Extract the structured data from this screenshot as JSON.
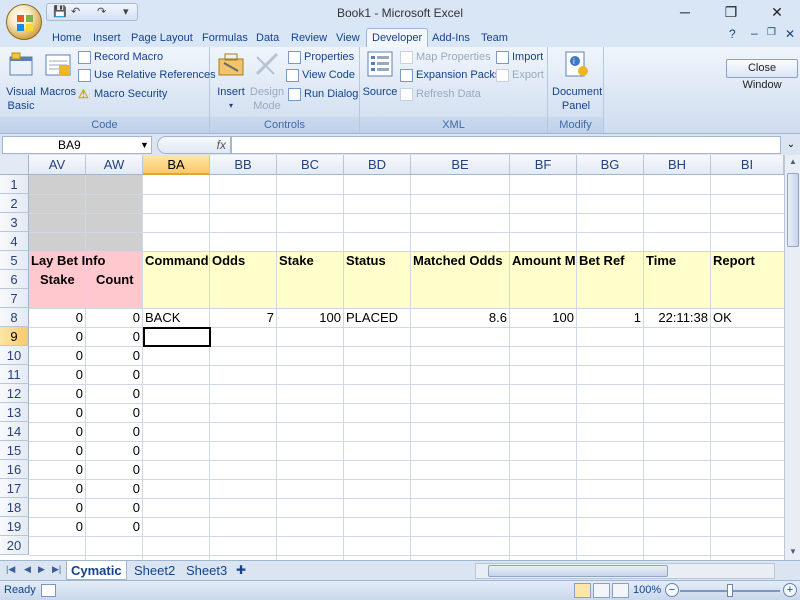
{
  "window": {
    "title": "Book1 - Microsoft Excel",
    "minimize": "─",
    "restore": "❐",
    "close": "✕"
  },
  "qat": {
    "save": "💾",
    "undo": "↶",
    "redo": "↷",
    "customize": "▾"
  },
  "tabs": [
    "Home",
    "Insert",
    "Page Layout",
    "Formulas",
    "Data",
    "Review",
    "View",
    "Developer",
    "Add-Ins",
    "Team"
  ],
  "active_tab": "Developer",
  "ribbon_right": {
    "help": "?",
    "mini": "–",
    "restore": "❐",
    "close": "✕"
  },
  "ribbon": {
    "code": {
      "label": "Code",
      "visual_basic": "Visual Basic",
      "macros": "Macros",
      "record_macro": "Record Macro",
      "relative_refs": "Use Relative References",
      "macro_security": "Macro Security"
    },
    "controls": {
      "label": "Controls",
      "insert": "Insert",
      "design_mode": "Design Mode",
      "properties": "Properties",
      "view_code": "View Code",
      "run_dialog": "Run Dialog"
    },
    "xml": {
      "label": "XML",
      "source": "Source",
      "map_properties": "Map Properties",
      "expansion_packs": "Expansion Packs",
      "refresh_data": "Refresh Data",
      "import": "Import",
      "export": "Export"
    },
    "modify": {
      "label": "Modify",
      "document_panel": "Document Panel"
    },
    "close_window": "Close Window"
  },
  "formula_bar": {
    "name_box": "BA9",
    "fx": "fx",
    "value": ""
  },
  "columns": [
    "AV",
    "AW",
    "BA",
    "BB",
    "BC",
    "BD",
    "BE",
    "BF",
    "BG",
    "BH",
    "BI"
  ],
  "selected_column": "BA",
  "rows": [
    "1",
    "2",
    "3",
    "4",
    "5",
    "6",
    "7",
    "8",
    "9",
    "10",
    "11",
    "12",
    "13",
    "14",
    "15",
    "16",
    "17",
    "18",
    "19",
    "20"
  ],
  "selected_row": "9",
  "headers": {
    "lay_bet_info": "Lay Bet Info",
    "stake": "Stake",
    "count": "Count",
    "command": "Command",
    "odds": "Odds",
    "stake2": "Stake",
    "status": "Status",
    "matched_odds": "Matched Odds",
    "amount_m": "Amount M",
    "bet_ref": "Bet Ref",
    "time": "Time",
    "report": "Report"
  },
  "row8": {
    "stake": "0",
    "count": "0",
    "command": "BACK",
    "odds": "7",
    "stake2": "100",
    "status": "PLACED",
    "matched_odds": "8.6",
    "amount": "100",
    "bet_ref": "1",
    "time": "22:11:38",
    "report": "OK"
  },
  "zero_rows": [
    {
      "stake": "0",
      "count": "0"
    },
    {
      "stake": "0",
      "count": "0"
    },
    {
      "stake": "0",
      "count": "0"
    },
    {
      "stake": "0",
      "count": "0"
    },
    {
      "stake": "0",
      "count": "0"
    },
    {
      "stake": "0",
      "count": "0"
    },
    {
      "stake": "0",
      "count": "0"
    },
    {
      "stake": "0",
      "count": "0"
    },
    {
      "stake": "0",
      "count": "0"
    },
    {
      "stake": "0",
      "count": "0"
    },
    {
      "stake": "0",
      "count": "0"
    }
  ],
  "sheets": [
    "Cymatic",
    "Sheet2",
    "Sheet3"
  ],
  "active_sheet": "Cymatic",
  "status": {
    "text": "Ready",
    "zoom": "100%"
  },
  "colors": {
    "pink": "#ffc7ce",
    "yellow": "#ffffcc",
    "gray": "#cfcfcf",
    "selection": "#f9c969"
  }
}
